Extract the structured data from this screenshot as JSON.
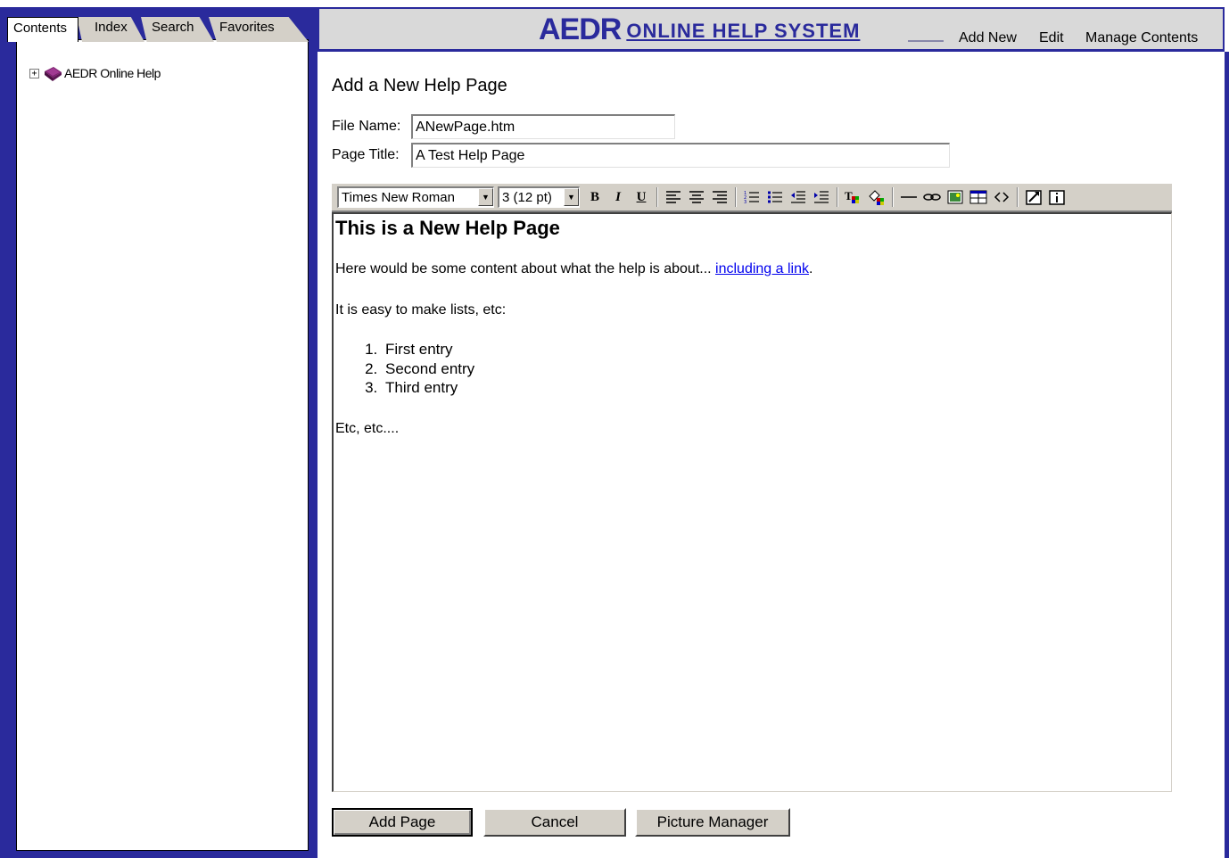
{
  "left": {
    "tabs": [
      {
        "label": "Contents",
        "active": true
      },
      {
        "label": "Index",
        "active": false
      },
      {
        "label": "Search",
        "active": false
      },
      {
        "label": "Favorites",
        "active": false
      }
    ],
    "tree": {
      "expander": "+",
      "icon": "book-icon",
      "label": "AEDR Online Help"
    }
  },
  "header": {
    "logo_bold": "AEDR",
    "logo_rest": "ONLINE HELP SYSTEM",
    "links": [
      "Add New",
      "Edit",
      "Manage Contents"
    ]
  },
  "form": {
    "heading": "Add a New Help Page",
    "file_name_label": "File Name:",
    "file_name_value": "ANewPage.htm",
    "page_title_label": "Page Title:",
    "page_title_value": "A Test Help Page"
  },
  "toolbar": {
    "font_value": "Times New Roman",
    "size_value": "3 (12 pt)",
    "bold": "B",
    "italic": "I",
    "underline": "U",
    "icons": [
      "align-left-icon",
      "align-center-icon",
      "align-right-icon",
      "ordered-list-icon",
      "unordered-list-icon",
      "outdent-icon",
      "indent-icon",
      "font-color-icon",
      "highlight-color-icon",
      "horizontal-rule-icon",
      "link-icon",
      "image-icon",
      "table-icon",
      "html-source-icon",
      "popup-edit-icon",
      "about-icon"
    ]
  },
  "document": {
    "heading": "This is a New Help Page",
    "para1_text": "Here would be some content about what the help is about... ",
    "para1_link": "including a link",
    "para1_end": ".",
    "para2": "It is easy to make lists, etc:",
    "list": [
      "First entry",
      "Second entry",
      "Third entry"
    ],
    "para3": "Etc, etc...."
  },
  "buttons": {
    "add_page": "Add Page",
    "cancel": "Cancel",
    "picture_manager": "Picture Manager"
  },
  "colors": {
    "frame_blue": "#2a2a9c",
    "header_gray": "#d9d9d9",
    "button_face": "#d4d0c8",
    "link_blue": "#0000ee",
    "book_purple": "#7a1f6e"
  }
}
